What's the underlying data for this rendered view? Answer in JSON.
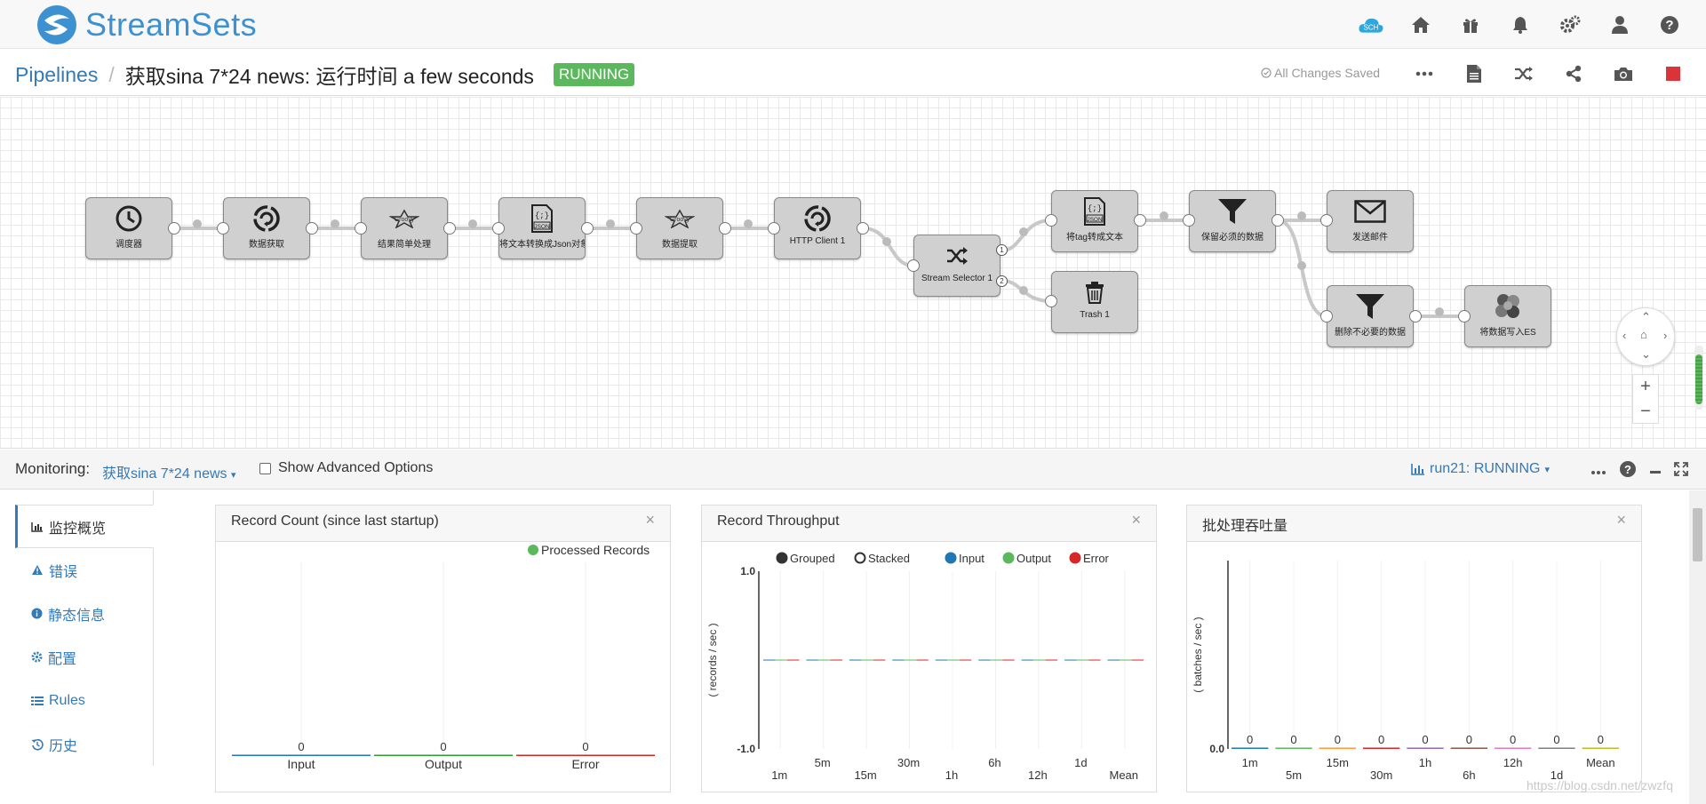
{
  "brand": {
    "name": "StreamSets",
    "sch_label": "SCH"
  },
  "header": {
    "breadcrumb_root": "Pipelines",
    "pipeline_title": "获取sina 7*24 news:  运行时间  a few seconds",
    "status_badge": "RUNNING",
    "save_status": "All Changes Saved"
  },
  "stages": [
    {
      "id": "s1",
      "label": "调度器",
      "icon": "clock-icon"
    },
    {
      "id": "s2",
      "label": "数据获取",
      "icon": "http-refresh-icon"
    },
    {
      "id": "s3",
      "label": "结果简单处理",
      "icon": "groovy-star-icon"
    },
    {
      "id": "s4",
      "label": "将文本转换成Json对象",
      "icon": "json-file-icon"
    },
    {
      "id": "s5",
      "label": "数据提取",
      "icon": "groovy-star-icon"
    },
    {
      "id": "s6",
      "label": "HTTP Client 1",
      "icon": "http-refresh-icon"
    },
    {
      "id": "s7",
      "label": "Stream Selector 1",
      "icon": "shuffle-icon"
    },
    {
      "id": "s8",
      "label": "将tag转成文本",
      "icon": "json-file-icon"
    },
    {
      "id": "s9",
      "label": "Trash 1",
      "icon": "trash-icon"
    },
    {
      "id": "s10",
      "label": "保留必须的数据",
      "icon": "filter-icon"
    },
    {
      "id": "s11",
      "label": "发送邮件",
      "icon": "envelope-icon"
    },
    {
      "id": "s12",
      "label": "删除不必要的数据",
      "icon": "filter-icon"
    },
    {
      "id": "s13",
      "label": "将数据写入ES",
      "icon": "elasticsearch-icon"
    }
  ],
  "selector_outputs": [
    "1",
    "2"
  ],
  "monitoring": {
    "label": "Monitoring:",
    "pipeline_name": "获取sina 7*24 news",
    "advanced_options": "Show Advanced Options",
    "run_status": "run21: RUNNING"
  },
  "sidenav": [
    {
      "label": "监控概览",
      "icon": "bar-chart-icon",
      "active": true
    },
    {
      "label": "错误",
      "icon": "warning-icon",
      "active": false
    },
    {
      "label": "静态信息",
      "icon": "info-icon",
      "active": false
    },
    {
      "label": "配置",
      "icon": "gear-icon",
      "active": false
    },
    {
      "label": "Rules",
      "icon": "list-icon",
      "active": false
    },
    {
      "label": "历史",
      "icon": "history-icon",
      "active": false
    }
  ],
  "panels": {
    "record_count": {
      "title": "Record Count (since last startup)",
      "close": "×"
    },
    "throughput": {
      "title": "Record Throughput",
      "close": "×"
    },
    "batch": {
      "title": "批处理吞吐量",
      "close": "×"
    }
  },
  "chart_data": [
    {
      "type": "bar",
      "categories": [
        "Input",
        "Output",
        "Error"
      ],
      "values": [
        0,
        0,
        0
      ],
      "legend": [
        "Processed Records"
      ],
      "colors": [
        "#1f77b4",
        "#2ca02c",
        "#d62728"
      ],
      "legend_color": "#5cb85c"
    },
    {
      "type": "bar",
      "categories": [
        "1m",
        "5m",
        "15m",
        "30m",
        "1h",
        "6h",
        "12h",
        "1d",
        "Mean"
      ],
      "series": [
        {
          "name": "Input",
          "values": [
            0,
            0,
            0,
            0,
            0,
            0,
            0,
            0,
            0
          ]
        },
        {
          "name": "Output",
          "values": [
            0,
            0,
            0,
            0,
            0,
            0,
            0,
            0,
            0
          ]
        },
        {
          "name": "Error",
          "values": [
            0,
            0,
            0,
            0,
            0,
            0,
            0,
            0,
            0
          ]
        }
      ],
      "modes": [
        "Grouped",
        "Stacked"
      ],
      "ylabel": "( records / sec )",
      "ylim": [
        -1.0,
        1.0
      ],
      "ytick_labels": [
        "1.0",
        "-1.0"
      ],
      "colors": [
        "#1f77b4",
        "#5cb85c",
        "#d62728"
      ]
    },
    {
      "type": "bar",
      "categories": [
        "1m",
        "5m",
        "15m",
        "30m",
        "1h",
        "6h",
        "12h",
        "1d",
        "Mean"
      ],
      "values": [
        0,
        0,
        0,
        0,
        0,
        0,
        0,
        0,
        0
      ],
      "ylabel": "( batches / sec )",
      "ytick_labels": [
        "0.0"
      ],
      "colors": [
        "#1f77b4",
        "#5cb85c",
        "#ff9933",
        "#d62728",
        "#9467bd",
        "#8c564b",
        "#e377c2",
        "#7f7f7f",
        "#bcbd22"
      ]
    }
  ],
  "watermark": "https://blog.csdn.net/zwzfq"
}
